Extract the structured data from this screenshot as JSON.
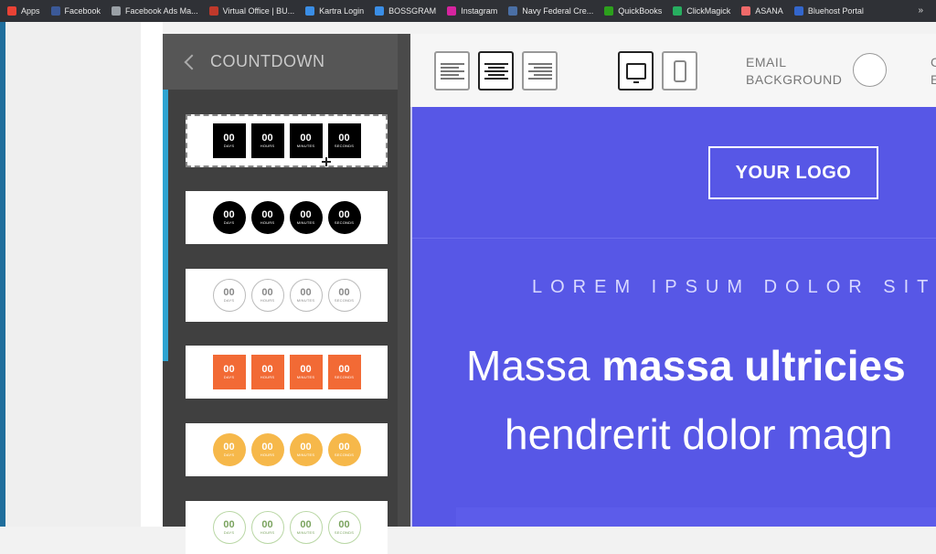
{
  "bookmarks": [
    {
      "label": "Apps",
      "icon": "apps-grid-icon",
      "color": "#e94235"
    },
    {
      "label": "Facebook",
      "icon": "facebook-icon",
      "color": "#3b5998"
    },
    {
      "label": "Facebook Ads Ma...",
      "icon": "page-icon",
      "color": "#9aa0a6"
    },
    {
      "label": "Virtual Office | BU...",
      "icon": "office-icon",
      "color": "#c0392b"
    },
    {
      "label": "Kartra Login",
      "icon": "kartra-icon",
      "color": "#3a8ee6"
    },
    {
      "label": "BOSSGRAM",
      "icon": "bossgram-icon",
      "color": "#3a8ee6"
    },
    {
      "label": "Instagram",
      "icon": "instagram-icon",
      "color": "#d6249f"
    },
    {
      "label": "Navy Federal Cre...",
      "icon": "globe-icon",
      "color": "#4a6fa5"
    },
    {
      "label": "QuickBooks",
      "icon": "quickbooks-icon",
      "color": "#2ca01c"
    },
    {
      "label": "ClickMagick",
      "icon": "clickmagick-icon",
      "color": "#27ae60"
    },
    {
      "label": "ASANA",
      "icon": "asana-icon",
      "color": "#f06a6a"
    },
    {
      "label": "Bluehost Portal",
      "icon": "bluehost-icon",
      "color": "#3366cc"
    }
  ],
  "bookmarks_more": "»",
  "panel": {
    "title": "COUNTDOWN",
    "units": [
      "DAYS",
      "HOURS",
      "MINUTES",
      "SECONDS"
    ],
    "value": "00",
    "styles": [
      {
        "name": "black-squares",
        "selected": true
      },
      {
        "name": "black-circles",
        "selected": false
      },
      {
        "name": "outline-circles",
        "selected": false
      },
      {
        "name": "orange-squares",
        "selected": false
      },
      {
        "name": "yellow-circles",
        "selected": false
      },
      {
        "name": "green-outline-circles",
        "selected": false
      }
    ]
  },
  "toolbar": {
    "align_buttons": [
      "align-left-icon",
      "align-center-icon",
      "align-right-icon"
    ],
    "device_buttons": [
      "desktop-icon",
      "mobile-icon"
    ],
    "email_bg_line1": "EMAIL",
    "email_bg_line2": "BACKGROUND",
    "more_line1": "C",
    "more_line2": "E"
  },
  "preview": {
    "logo": "YOUR LOGO",
    "kicker": "LOREM IPSUM DOLOR SIT",
    "headline_regular": "Massa ",
    "headline_bold": "massa ultricies",
    "headline_line2": "hendrerit dolor magn",
    "bg_color": "#5757e6"
  }
}
